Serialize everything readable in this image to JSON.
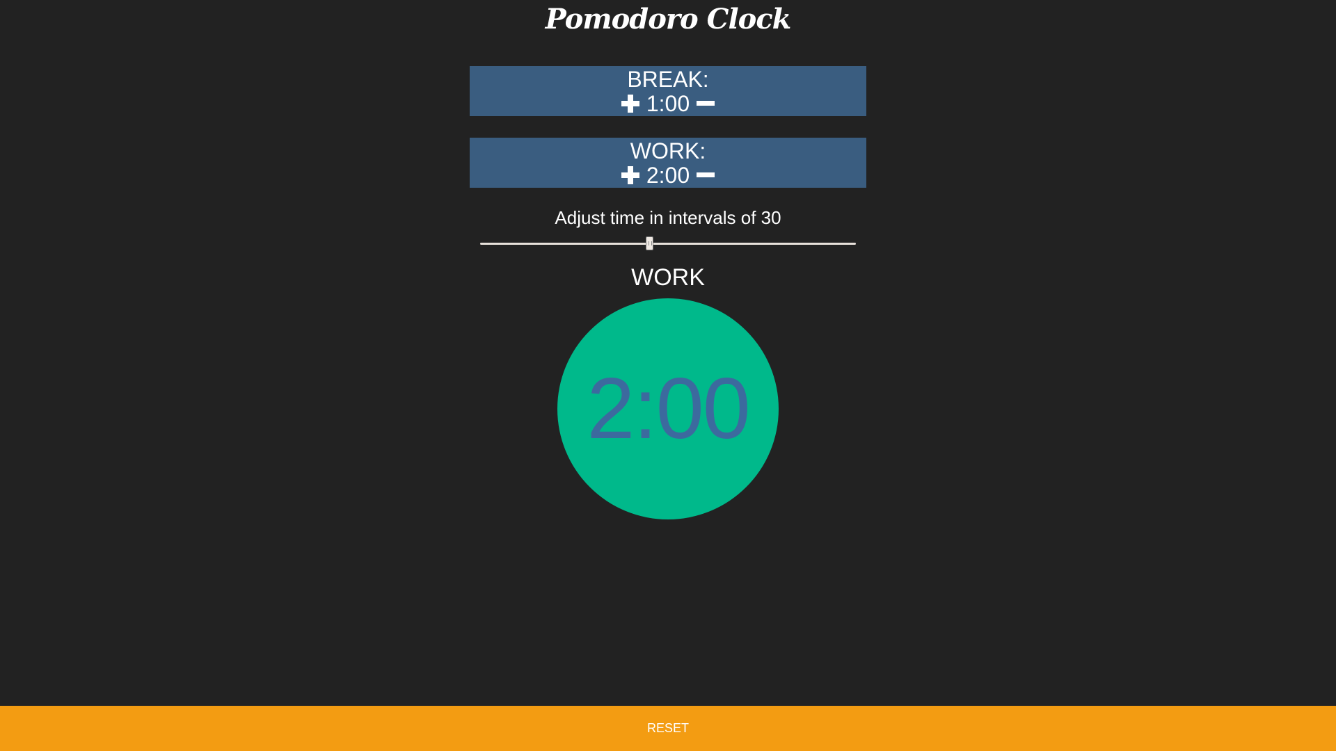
{
  "app": {
    "title": "Pomodoro Clock"
  },
  "break_panel": {
    "label": "BREAK:",
    "value": "1:00"
  },
  "work_panel": {
    "label": "WORK:",
    "value": "2:00"
  },
  "interval": {
    "text": "Adjust time in intervals of 30",
    "slider_fraction": 0.45
  },
  "timer": {
    "mode": "WORK",
    "display": "2:00"
  },
  "reset": {
    "label": "RESET"
  },
  "colors": {
    "background": "#222222",
    "panel": "#3a5d80",
    "timer_circle": "#00b98b",
    "timer_text": "#3c6a9e",
    "reset_bar": "#f39c12"
  },
  "icons": {
    "increment": "plus-icon",
    "decrement": "minus-icon"
  }
}
